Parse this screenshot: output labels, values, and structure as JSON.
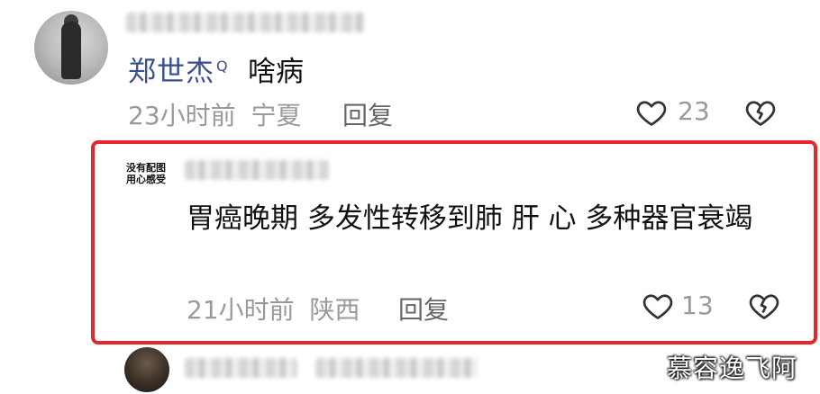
{
  "comment1": {
    "username": "郑世杰",
    "search_mark": "Q",
    "text": "啥病",
    "time": "23小时前",
    "location": "宁夏",
    "reply_label": "回复",
    "like_count": "23"
  },
  "reply": {
    "avatar_text_line1": "没有配图",
    "avatar_text_line2": "用心感受",
    "text": "胃癌晚期 多发性转移到肺 肝 心 多种器官衰竭",
    "time": "21小时前",
    "location": "陕西",
    "reply_label": "回复",
    "like_count": "13"
  },
  "watermark": "慕容逸飞阿",
  "colors": {
    "highlight_border": "#e5262b",
    "username": "#3a4d8f",
    "meta": "#9a9a9a"
  }
}
